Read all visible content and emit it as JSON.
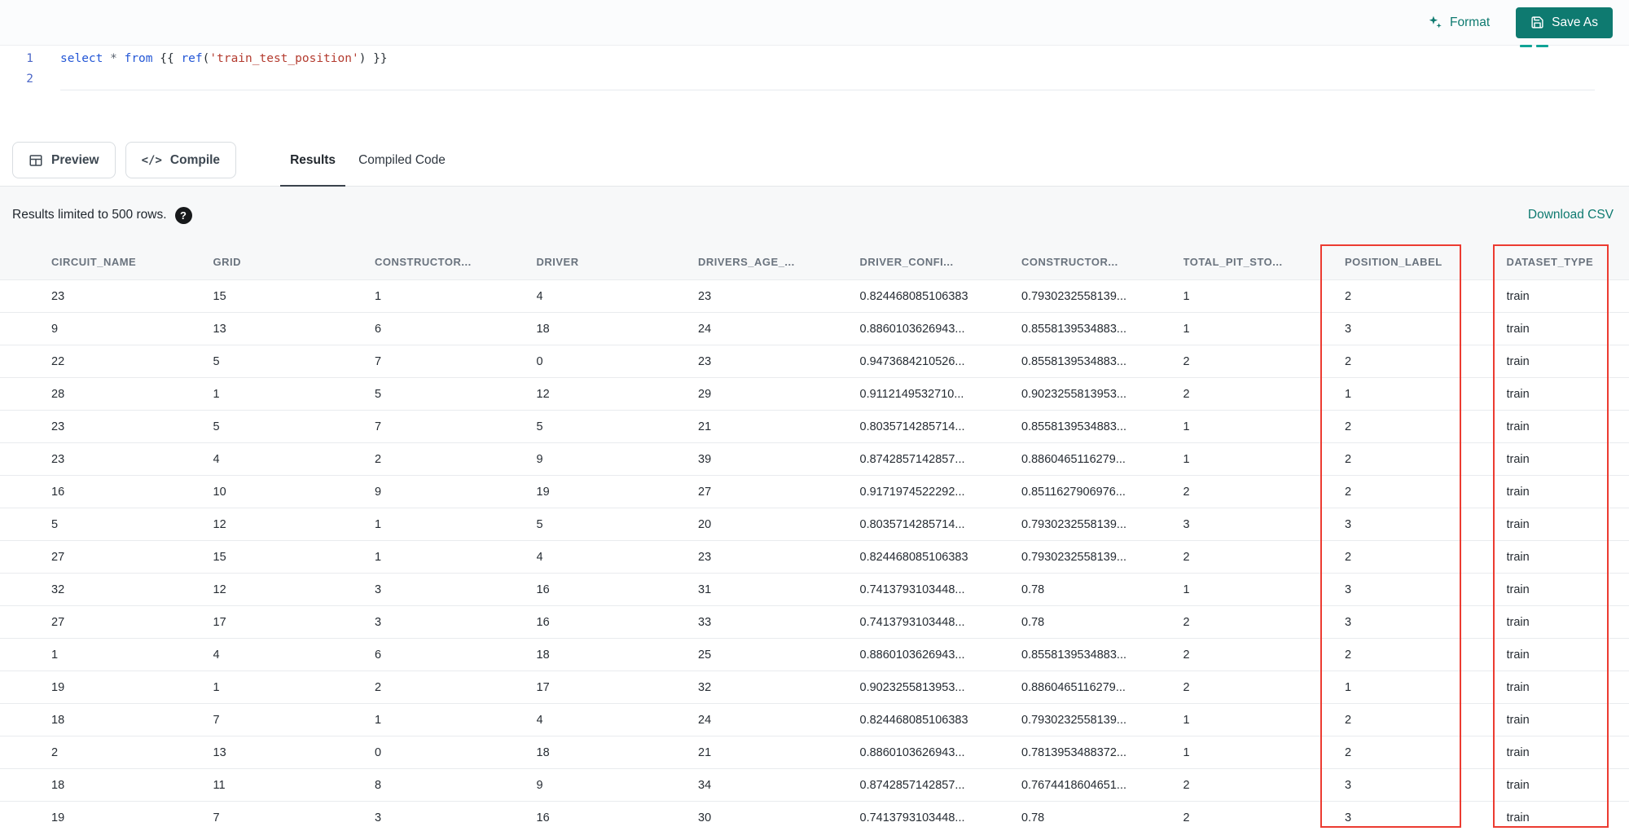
{
  "toolbar": {
    "format_label": "Format",
    "save_as_label": "Save As"
  },
  "editor": {
    "lines": [
      {
        "number": "1",
        "tokens": [
          {
            "text": "select",
            "type": "keyword"
          },
          {
            "text": " ",
            "type": "plain"
          },
          {
            "text": "*",
            "type": "operator"
          },
          {
            "text": " ",
            "type": "plain"
          },
          {
            "text": "from",
            "type": "keyword"
          },
          {
            "text": " {{ ",
            "type": "plain"
          },
          {
            "text": "ref",
            "type": "function"
          },
          {
            "text": "(",
            "type": "plain"
          },
          {
            "text": "'train_test_position'",
            "type": "string"
          },
          {
            "text": ")",
            "type": "plain"
          },
          {
            "text": " }}",
            "type": "plain"
          }
        ]
      },
      {
        "number": "2",
        "tokens": []
      }
    ]
  },
  "actions": {
    "preview_label": "Preview",
    "compile_label": "Compile"
  },
  "tabs": [
    {
      "label": "Results",
      "active": true
    },
    {
      "label": "Compiled Code",
      "active": false
    }
  ],
  "results": {
    "limit_notice": "Results limited to 500 rows.",
    "help_glyph": "?",
    "download_label": "Download CSV"
  },
  "icons": {
    "compile_glyph": "</>"
  },
  "table": {
    "columns": [
      "CIRCUIT_NAME",
      "GRID",
      "CONSTRUCTOR...",
      "DRIVER",
      "DRIVERS_AGE_...",
      "DRIVER_CONFI...",
      "CONSTRUCTOR...",
      "TOTAL_PIT_STO...",
      "POSITION_LABEL",
      "DATASET_TYPE"
    ],
    "rows": [
      [
        "23",
        "15",
        "1",
        "4",
        "23",
        "0.824468085106383",
        "0.7930232558139...",
        "1",
        "2",
        "train"
      ],
      [
        "9",
        "13",
        "6",
        "18",
        "24",
        "0.8860103626943...",
        "0.8558139534883...",
        "1",
        "3",
        "train"
      ],
      [
        "22",
        "5",
        "7",
        "0",
        "23",
        "0.9473684210526...",
        "0.8558139534883...",
        "2",
        "2",
        "train"
      ],
      [
        "28",
        "1",
        "5",
        "12",
        "29",
        "0.9112149532710...",
        "0.9023255813953...",
        "2",
        "1",
        "train"
      ],
      [
        "23",
        "5",
        "7",
        "5",
        "21",
        "0.8035714285714...",
        "0.8558139534883...",
        "1",
        "2",
        "train"
      ],
      [
        "23",
        "4",
        "2",
        "9",
        "39",
        "0.8742857142857...",
        "0.8860465116279...",
        "1",
        "2",
        "train"
      ],
      [
        "16",
        "10",
        "9",
        "19",
        "27",
        "0.9171974522292...",
        "0.8511627906976...",
        "2",
        "2",
        "train"
      ],
      [
        "5",
        "12",
        "1",
        "5",
        "20",
        "0.8035714285714...",
        "0.7930232558139...",
        "3",
        "3",
        "train"
      ],
      [
        "27",
        "15",
        "1",
        "4",
        "23",
        "0.824468085106383",
        "0.7930232558139...",
        "2",
        "2",
        "train"
      ],
      [
        "32",
        "12",
        "3",
        "16",
        "31",
        "0.7413793103448...",
        "0.78",
        "1",
        "3",
        "train"
      ],
      [
        "27",
        "17",
        "3",
        "16",
        "33",
        "0.7413793103448...",
        "0.78",
        "2",
        "3",
        "train"
      ],
      [
        "1",
        "4",
        "6",
        "18",
        "25",
        "0.8860103626943...",
        "0.8558139534883...",
        "2",
        "2",
        "train"
      ],
      [
        "19",
        "1",
        "2",
        "17",
        "32",
        "0.9023255813953...",
        "0.8860465116279...",
        "2",
        "1",
        "train"
      ],
      [
        "18",
        "7",
        "1",
        "4",
        "24",
        "0.824468085106383",
        "0.7930232558139...",
        "1",
        "2",
        "train"
      ],
      [
        "2",
        "13",
        "0",
        "18",
        "21",
        "0.8860103626943...",
        "0.7813953488372...",
        "1",
        "2",
        "train"
      ],
      [
        "18",
        "11",
        "8",
        "9",
        "34",
        "0.8742857142857...",
        "0.7674418604651...",
        "2",
        "3",
        "train"
      ],
      [
        "19",
        "7",
        "3",
        "16",
        "30",
        "0.7413793103448...",
        "0.78",
        "2",
        "3",
        "train"
      ]
    ],
    "highlighted_columns": [
      "POSITION_LABEL",
      "DATASET_TYPE"
    ],
    "highlight_color": "#ec3b31"
  },
  "colors": {
    "accent_teal": "#0e7a70",
    "keyword_blue": "#2457d6",
    "string_red": "#b43c30"
  }
}
